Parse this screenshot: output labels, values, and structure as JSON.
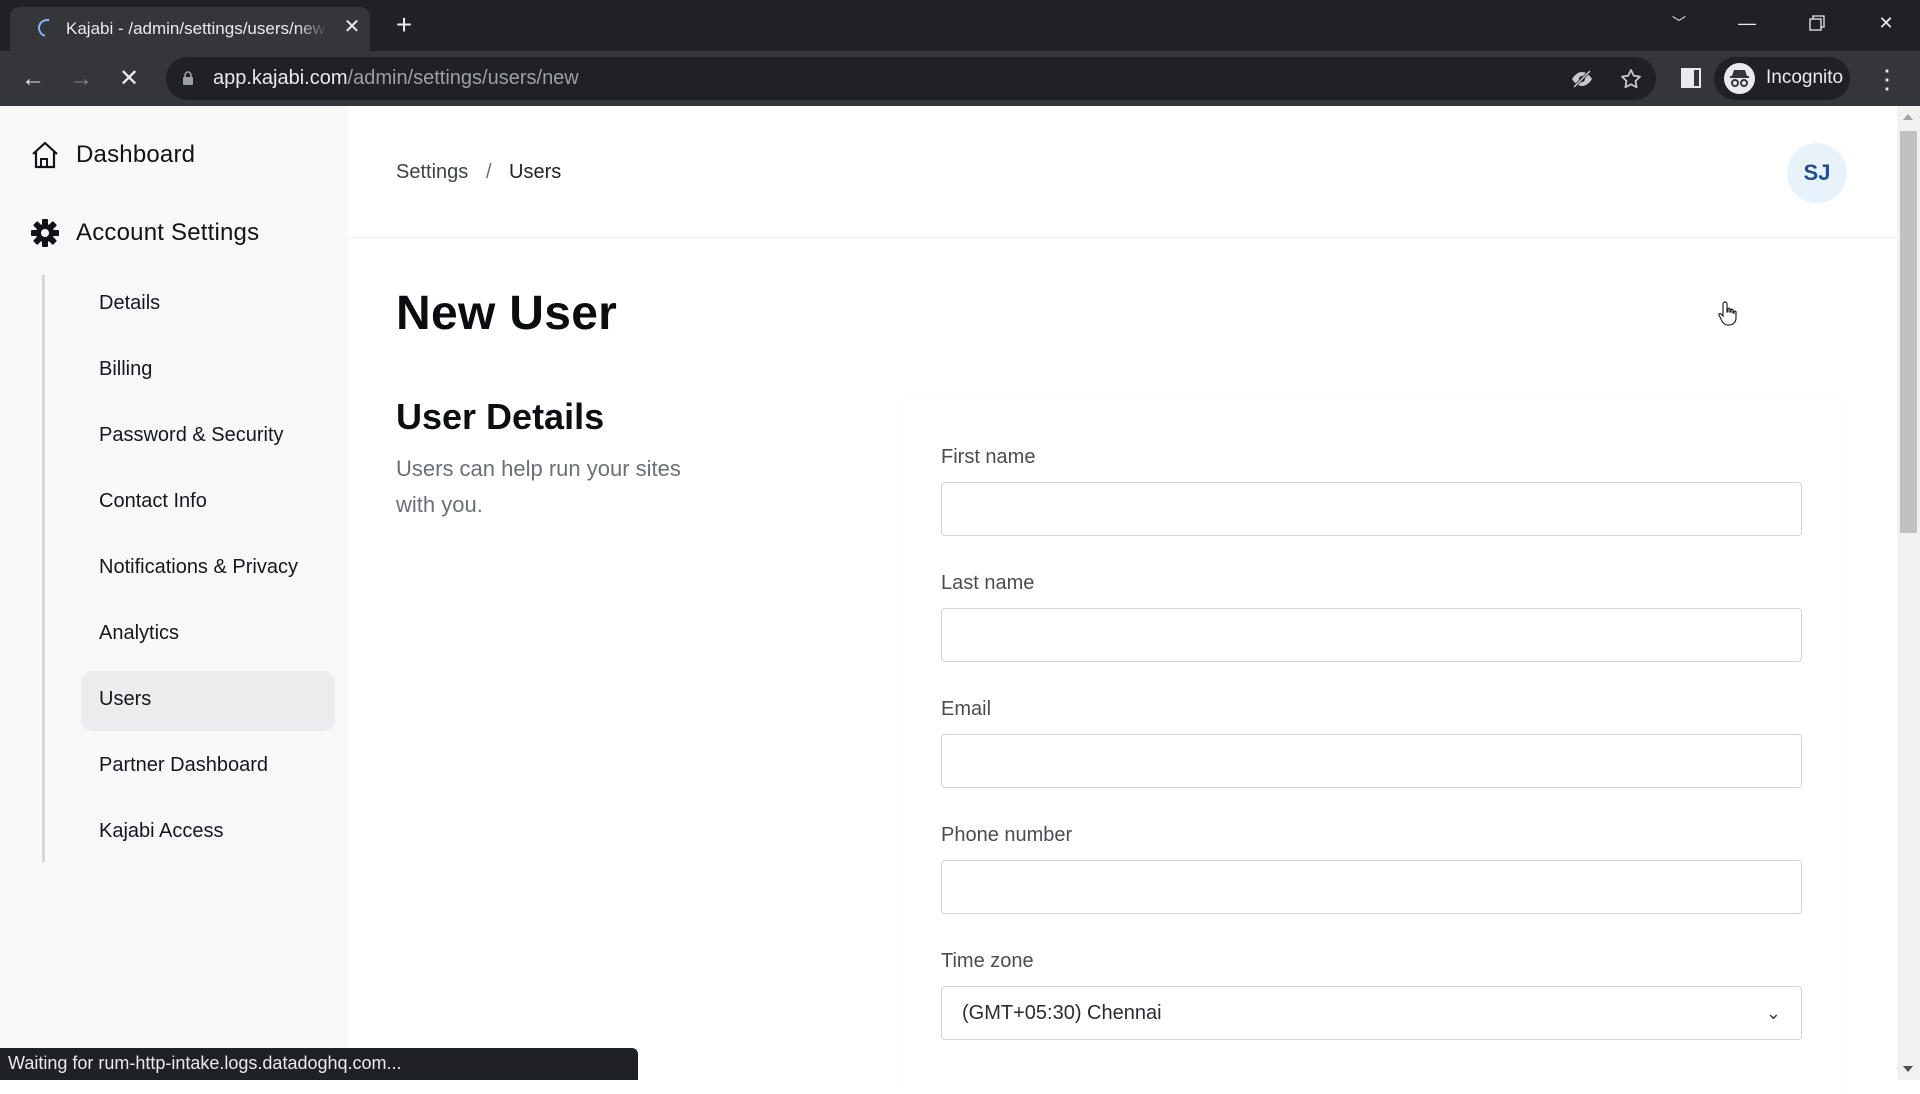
{
  "browser": {
    "tab_title": "Kajabi - /admin/settings/users/new",
    "url_host": "app.kajabi.com",
    "url_path": "/admin/settings/users/new",
    "profile_label": "Incognito",
    "status_text": "Waiting for rum-http-intake.logs.datadoghq.com..."
  },
  "sidebar": {
    "top_items": [
      {
        "label": "Dashboard",
        "icon": "home-icon"
      },
      {
        "label": "Account Settings",
        "icon": "gear-icon"
      }
    ],
    "sub_items": [
      {
        "label": "Details",
        "active": false
      },
      {
        "label": "Billing",
        "active": false
      },
      {
        "label": "Password & Security",
        "active": false
      },
      {
        "label": "Contact Info",
        "active": false
      },
      {
        "label": "Notifications & Privacy",
        "active": false
      },
      {
        "label": "Analytics",
        "active": false
      },
      {
        "label": "Users",
        "active": true
      },
      {
        "label": "Partner Dashboard",
        "active": false
      },
      {
        "label": "Kajabi Access",
        "active": false
      }
    ]
  },
  "header": {
    "breadcrumb": [
      "Settings",
      "Users"
    ],
    "breadcrumb_separator": "/",
    "avatar_initials": "SJ"
  },
  "main": {
    "title": "New User",
    "section_title": "User Details",
    "section_description": "Users can help run your sites with you.",
    "fields": [
      {
        "label": "First name",
        "value": "",
        "type": "text"
      },
      {
        "label": "Last name",
        "value": "",
        "type": "text"
      },
      {
        "label": "Email",
        "value": "",
        "type": "email"
      },
      {
        "label": "Phone number",
        "value": "",
        "type": "tel"
      },
      {
        "label": "Time zone",
        "value": "(GMT+05:30) Chennai",
        "type": "select"
      }
    ]
  },
  "colors": {
    "avatar_bg": "#e8f2fb",
    "avatar_text": "#1f4f8b",
    "sidebar_bg": "#f8f8f9",
    "active_item_bg": "#ececee"
  }
}
